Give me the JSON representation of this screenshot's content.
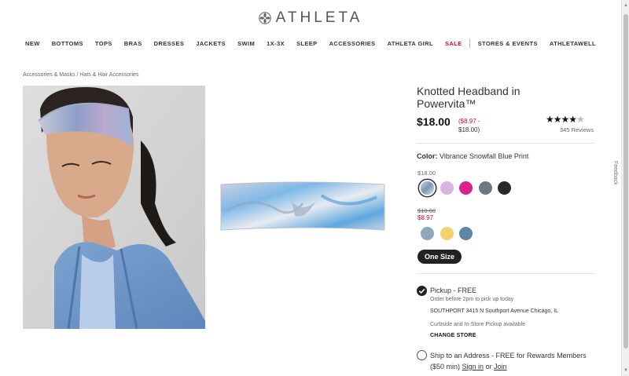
{
  "brand": {
    "name": "ATHLETA",
    "logo_icon": "flower-logo-icon"
  },
  "nav": [
    {
      "label": "NEW",
      "sale": false
    },
    {
      "label": "BOTTOMS",
      "sale": false
    },
    {
      "label": "TOPS",
      "sale": false
    },
    {
      "label": "BRAS",
      "sale": false
    },
    {
      "label": "DRESSES",
      "sale": false
    },
    {
      "label": "JACKETS",
      "sale": false
    },
    {
      "label": "SWIM",
      "sale": false
    },
    {
      "label": "1X-3X",
      "sale": false
    },
    {
      "label": "SLEEP",
      "sale": false
    },
    {
      "label": "ACCESSORIES",
      "sale": false
    },
    {
      "label": "ATHLETA GIRL",
      "sale": false
    },
    {
      "label": "SALE",
      "sale": true
    },
    {
      "label": "STORES & EVENTS",
      "sale": false
    },
    {
      "label": "ATHLETAWELL",
      "sale": false
    }
  ],
  "breadcrumb": {
    "first": "Accessories & Masks",
    "separator": " / ",
    "second": "Hats & Hair Accessories"
  },
  "product": {
    "title": "Knotted Headband in Powervita™",
    "price": "$18.00",
    "price_range_line1": "($8.97 -",
    "price_range_line2": "$18.00)",
    "stars": "★★★★",
    "half_star": "★",
    "rating": "4.5",
    "reviews": "345 Reviews"
  },
  "color": {
    "label": "Color:",
    "value": "Vibrance Snowfall Blue Print",
    "tier1_price": "$18.00",
    "tier2_original": "$18.00",
    "tier2_sale": "$8.97",
    "tier1_swatches": [
      "#8e9eb8",
      "#d8b4e2",
      "#d6218f",
      "#6e7882",
      "#2a2a2a"
    ],
    "tier2_swatches": [
      "#8fa6bd",
      "#f4d06f",
      "#5b87a8"
    ]
  },
  "size": {
    "label": "One Size"
  },
  "fulfillment": {
    "pickup_title": "Pickup - FREE",
    "pickup_time": "Order before 2pm to pick up today",
    "store": "SOUTHPORT 3415 N Southport Avenue  Chicago, IL",
    "pickup_note": "Curbside and In-Store Pickup available",
    "change_store": "CHANGE STORE",
    "ship_text": "Ship to an Address - FREE for Rewards Members ($50 min)",
    "sign_in": "Sign in",
    "or": "or",
    "join": "Join"
  },
  "feedback": "Feedback"
}
